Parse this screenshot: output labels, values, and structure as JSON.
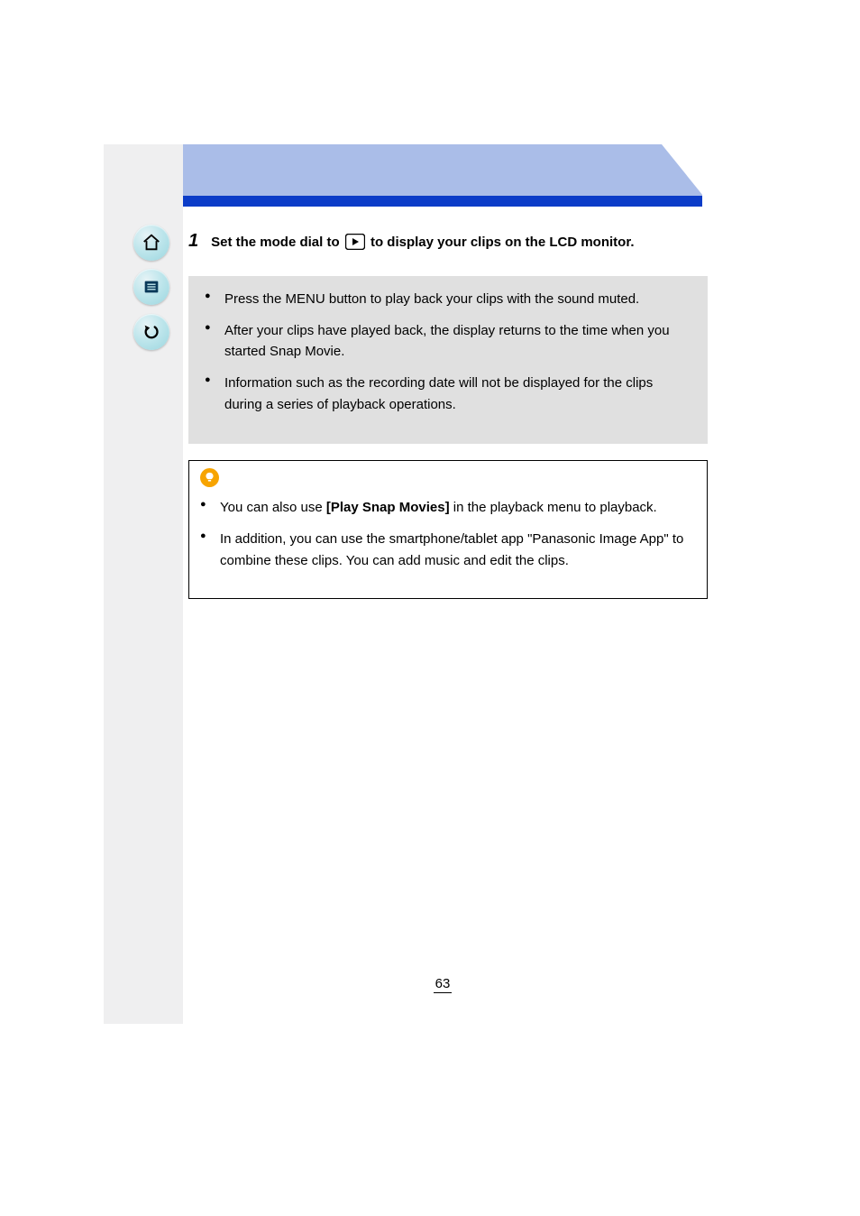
{
  "nav": {
    "home": "home",
    "contents": "contents",
    "back": "back"
  },
  "step": {
    "num": "1",
    "before_icon": "Set the mode dial to",
    "after_icon": " to display your clips on the LCD monitor."
  },
  "notes": {
    "items": [
      "Press the MENU button to play back your clips with the sound muted.",
      "After your clips have played back, the display returns to the time when you started Snap Movie.",
      "Information such as the recording date will not be displayed for the clips during a series of playback operations."
    ]
  },
  "tips": {
    "items": [
      {
        "prefix": "You can also use ",
        "bold": "[Play Snap Movies]",
        "suffix": " in the playback menu to playback."
      },
      {
        "prefix": "In addition, you can use the smartphone/tablet app ",
        "quote": "\"Panasonic Image App\"",
        "suffix": " to combine these clips. You can add music and edit the clips."
      }
    ]
  },
  "page_number": "63",
  "icons": {
    "play": "play-icon",
    "bulb": "bulb-icon"
  }
}
